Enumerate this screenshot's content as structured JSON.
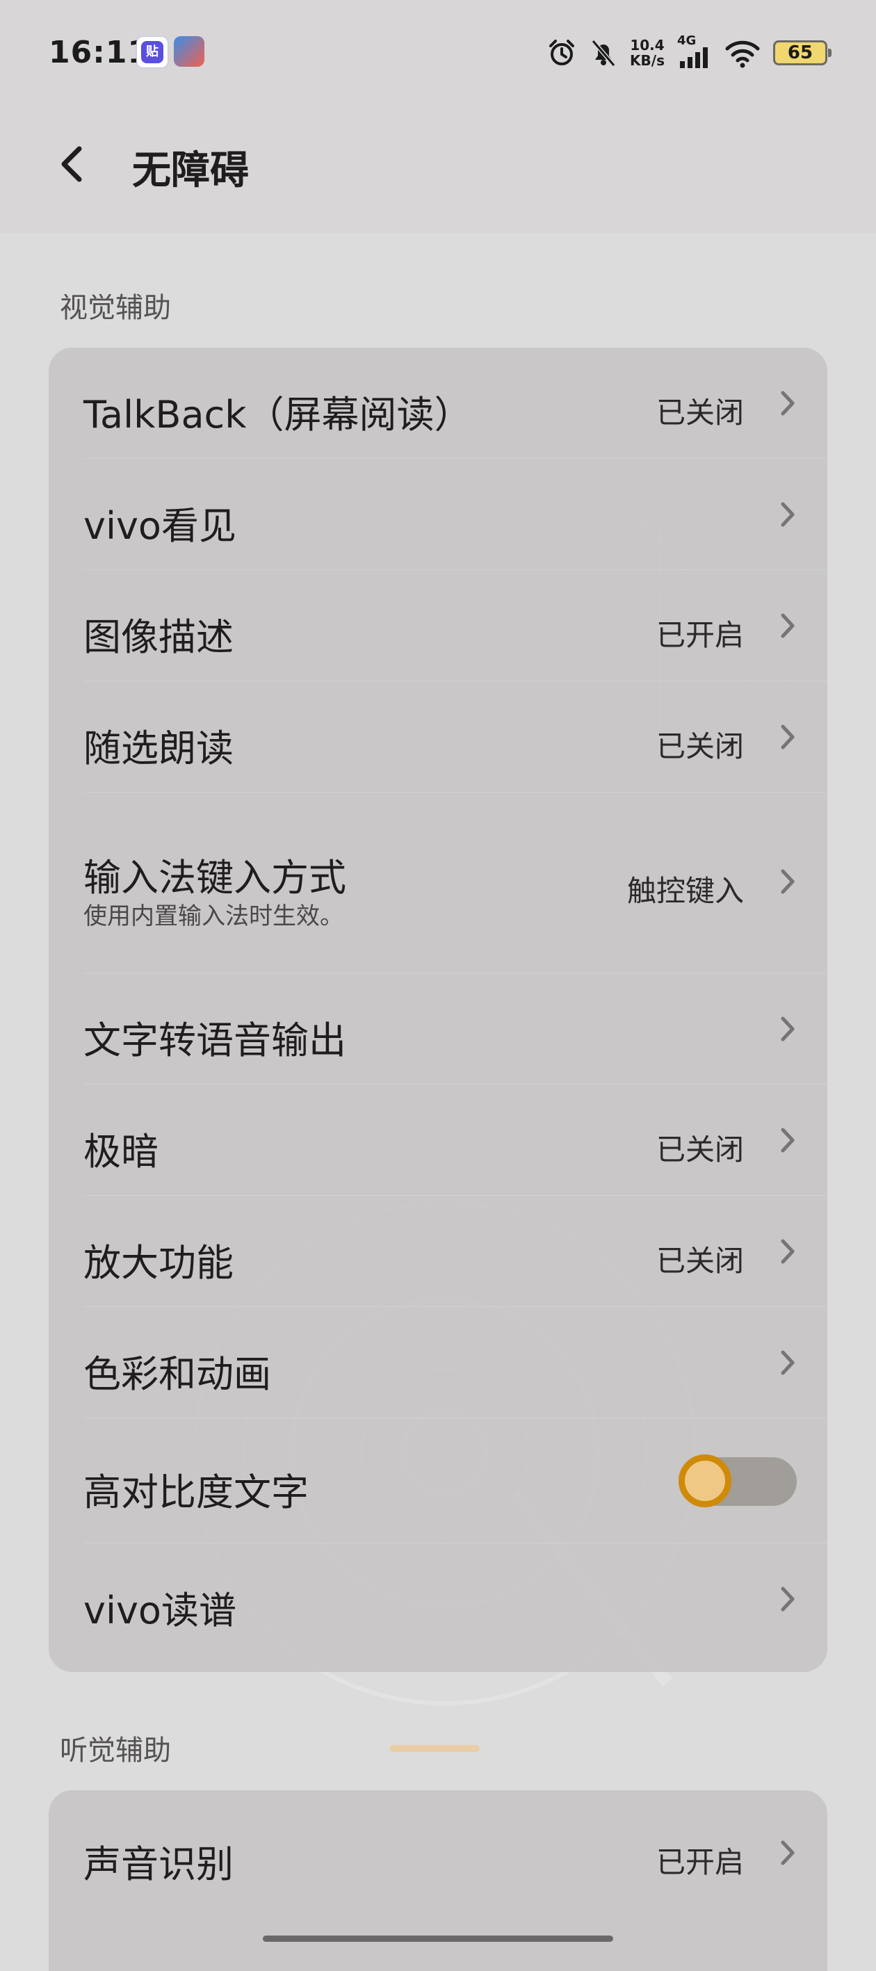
{
  "status_bar": {
    "time": "16:11",
    "app_icon_1_text": "贴",
    "net_speed_value": "10.4",
    "net_speed_unit": "KB/s",
    "network_type": "4G",
    "battery_level": "65"
  },
  "header": {
    "title": "无障碍"
  },
  "sections": {
    "visual": {
      "title": "视觉辅助",
      "items": [
        {
          "label": "TalkBack（屏幕阅读）",
          "value": "已关闭"
        },
        {
          "label": "vivo看见",
          "value": ""
        },
        {
          "label": "图像描述",
          "value": "已开启"
        },
        {
          "label": "随选朗读",
          "value": "已关闭"
        },
        {
          "label": "输入法键入方式",
          "sublabel": "使用内置输入法时生效。",
          "value": "触控键入"
        },
        {
          "label": "文字转语音输出",
          "value": ""
        },
        {
          "label": "极暗",
          "value": "已关闭"
        },
        {
          "label": "放大功能",
          "value": "已关闭"
        },
        {
          "label": "色彩和动画",
          "value": ""
        },
        {
          "label": "高对比度文字",
          "toggle_on": false
        },
        {
          "label": "vivo读谱",
          "value": ""
        }
      ]
    },
    "hearing": {
      "title": "听觉辅助",
      "items": [
        {
          "label": "声音识别",
          "value": "已开启"
        }
      ]
    }
  },
  "colors": {
    "toggle_accent": "#cf8a0a",
    "card_background": "#c4c2c2",
    "page_background": "#dddcdd"
  }
}
